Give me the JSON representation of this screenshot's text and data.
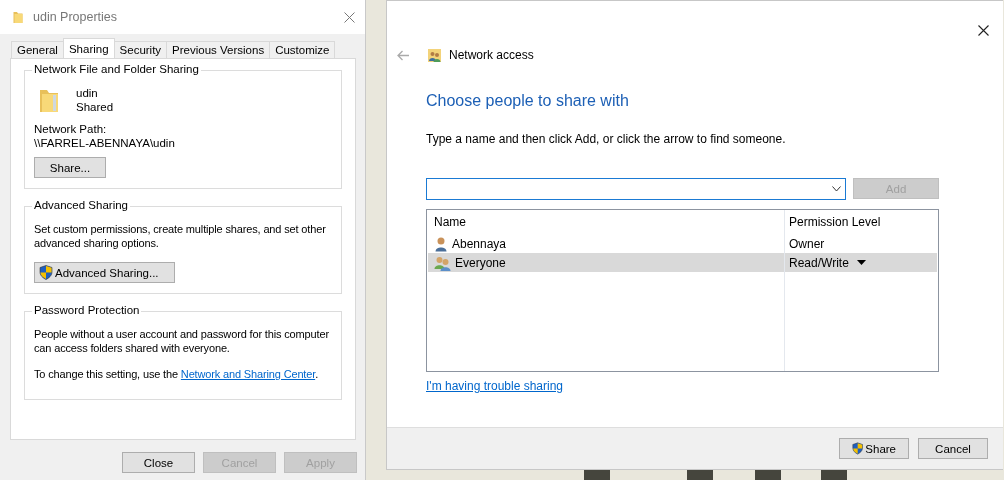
{
  "properties_window": {
    "title": "udin Properties",
    "tabs": [
      {
        "label": "General",
        "selected": false
      },
      {
        "label": "Sharing",
        "selected": true
      },
      {
        "label": "Security",
        "selected": false
      },
      {
        "label": "Previous Versions",
        "selected": false
      },
      {
        "label": "Customize",
        "selected": false
      }
    ],
    "network_sharing": {
      "heading": "Network File and Folder Sharing",
      "folder_name": "udin",
      "folder_status": "Shared",
      "path_label": "Network Path:",
      "path": "\\\\FARREL-ABENNAYA\\udin",
      "button": "Share..."
    },
    "advanced_sharing": {
      "heading": "Advanced Sharing",
      "description": "Set custom permissions, create multiple shares, and set other advanced sharing options.",
      "button": "Advanced Sharing..."
    },
    "password_protection": {
      "heading": "Password Protection",
      "description": "People without a user account and password for this computer can access folders shared with everyone.",
      "link_prefix": "To change this setting, use the ",
      "link": "Network and Sharing Center",
      "link_suffix": "."
    },
    "buttons": [
      {
        "label": "Close",
        "disabled": false
      },
      {
        "label": "Cancel",
        "disabled": true
      },
      {
        "label": "Apply",
        "disabled": true
      }
    ]
  },
  "share_dialog": {
    "title": "Network access",
    "heading": "Choose people to share with",
    "instruction": "Type a name and then click Add, or click the arrow to find someone.",
    "add_button": {
      "label": "Add",
      "disabled": true
    },
    "columns": [
      "Name",
      "Permission Level"
    ],
    "rows": [
      {
        "kind": "user",
        "name": "Abennaya",
        "permission": "Owner",
        "selected": false
      },
      {
        "kind": "group",
        "name": "Everyone",
        "permission": "Read/Write",
        "selected": true
      }
    ],
    "help_link": "I'm having trouble sharing",
    "buttons": [
      {
        "label": "Share",
        "shield": true
      },
      {
        "label": "Cancel",
        "shield": false
      }
    ]
  }
}
